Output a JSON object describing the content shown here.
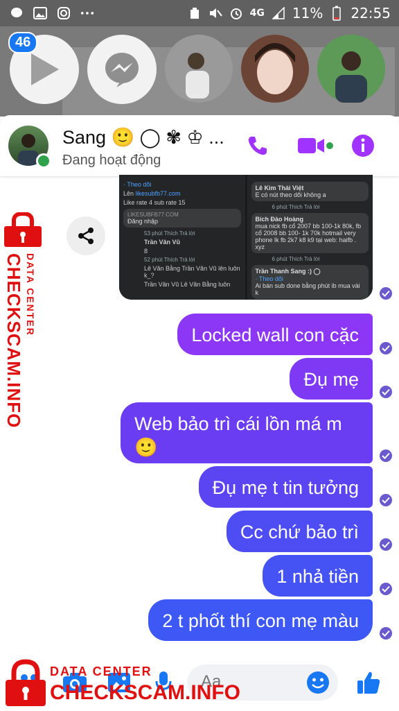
{
  "status_bar": {
    "network": "4G",
    "battery_percent": "11%",
    "time": "22:55"
  },
  "chat_heads": {
    "badge_count": "46"
  },
  "header": {
    "contact_name": "Sang 🙂 ◯ ✾ ♔ ...",
    "contact_status": "Đang hoạt động"
  },
  "shared_image": {
    "left_panel": {
      "follow": "· Theo dõi",
      "line1_prefix": "Lên ",
      "line1_link": "likesubfb77.com",
      "line2": "Like rate 4 sub rate 15",
      "site": "LIKESUBFB77.COM",
      "login": "Đăng nhập",
      "meta1": "53 phút   Thích   Trả lời",
      "user1": "Trần Văn Vũ",
      "user1_msg": "8",
      "meta2": "52 phút   Thích   Trả lời",
      "reply1": "Lê Văn Bằng  Trần Văn Vũ lên luôn k_?",
      "reply2": "Trần Văn Vũ  Lê Văn Bằng luôn"
    },
    "right_panel": {
      "user1": "Lê Kim Thái Việt",
      "user1_msg": "E có nút theo dõi không a",
      "meta1": "6 phút   Thích   Trả lời",
      "user2": "Bích Đào Hoàng",
      "user2_msg": "mua nick fb cổ 2007 bb 100-1k 80k, fb cổ 2008 bb 100- 1k 70k hotmail very phone lk fb 2k7 k8 k9 tại web: haifb . xyz",
      "meta2": "6 phút   Thích   Trả lời",
      "user3": "Trần Thanh Sang :) ◯",
      "user3_follow": "· Theo dõi",
      "user3_msg": "Ai bán sub done bằng phút ib mua vài k"
    }
  },
  "messages": [
    {
      "text": "Locked wall con cặc"
    },
    {
      "text": "Đụ mẹ"
    },
    {
      "text": "Web bảo trì cái lồn má m 🙂"
    },
    {
      "text": "Đụ mẹ t tin tưởng"
    },
    {
      "text": "Cc chứ bảo trì"
    },
    {
      "text": "1 nhả tiền"
    },
    {
      "text": "2 t phốt thí con mẹ màu"
    }
  ],
  "composer": {
    "placeholder": "Aa"
  },
  "watermark": {
    "side_main": "CHECKSCAM.INFO",
    "side_sub": "DATA CENTER",
    "bottom_sub": "DATA CENTER",
    "bottom_main": "CHECKSCAM.INFO"
  },
  "colors": {
    "accent": "#a033ff",
    "bubble_top": "#8b37f5",
    "bubble_bottom": "#3d5cf5",
    "online": "#31a24c",
    "watermark": "#e01010"
  },
  "icons": {
    "call": "phone-icon",
    "video": "video-icon",
    "info": "info-icon",
    "share": "share-icon",
    "camera": "camera-icon",
    "gallery": "gallery-icon",
    "mic": "microphone-icon",
    "emoji": "emoji-icon",
    "like": "thumbs-up-icon"
  }
}
